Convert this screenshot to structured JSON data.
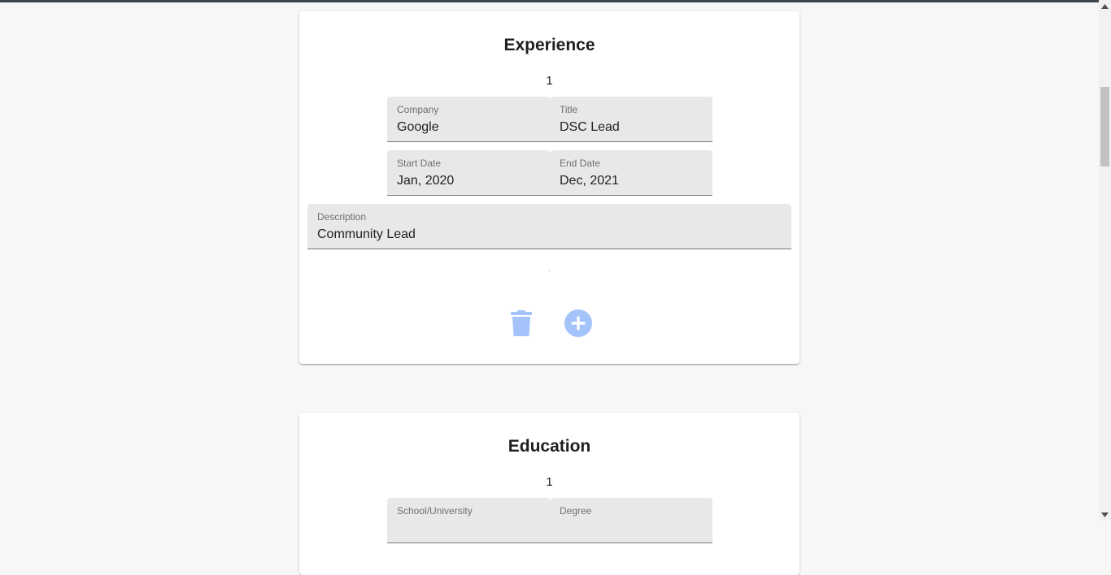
{
  "experience": {
    "title": "Experience",
    "entry_number": "1",
    "fields": {
      "company": {
        "label": "Company",
        "value": "Google"
      },
      "title": {
        "label": "Title",
        "value": "DSC Lead"
      },
      "start_date": {
        "label": "Start Date",
        "value": "Jan, 2020"
      },
      "end_date": {
        "label": "End Date",
        "value": "Dec, 2021"
      },
      "description": {
        "label": "Description",
        "value": "Community Lead"
      }
    },
    "actions": {
      "delete_icon": "trash-icon",
      "add_icon": "plus-circle-icon"
    }
  },
  "education": {
    "title": "Education",
    "entry_number": "1",
    "fields": {
      "school": {
        "label": "School/University",
        "value": ""
      },
      "degree": {
        "label": "Degree",
        "value": ""
      }
    }
  },
  "colors": {
    "page_background": "#f7f7f7",
    "card_background": "#ffffff",
    "field_background": "#e8e8e8",
    "action_icon": "#a4c3fa",
    "top_strip": "#3c4650"
  }
}
